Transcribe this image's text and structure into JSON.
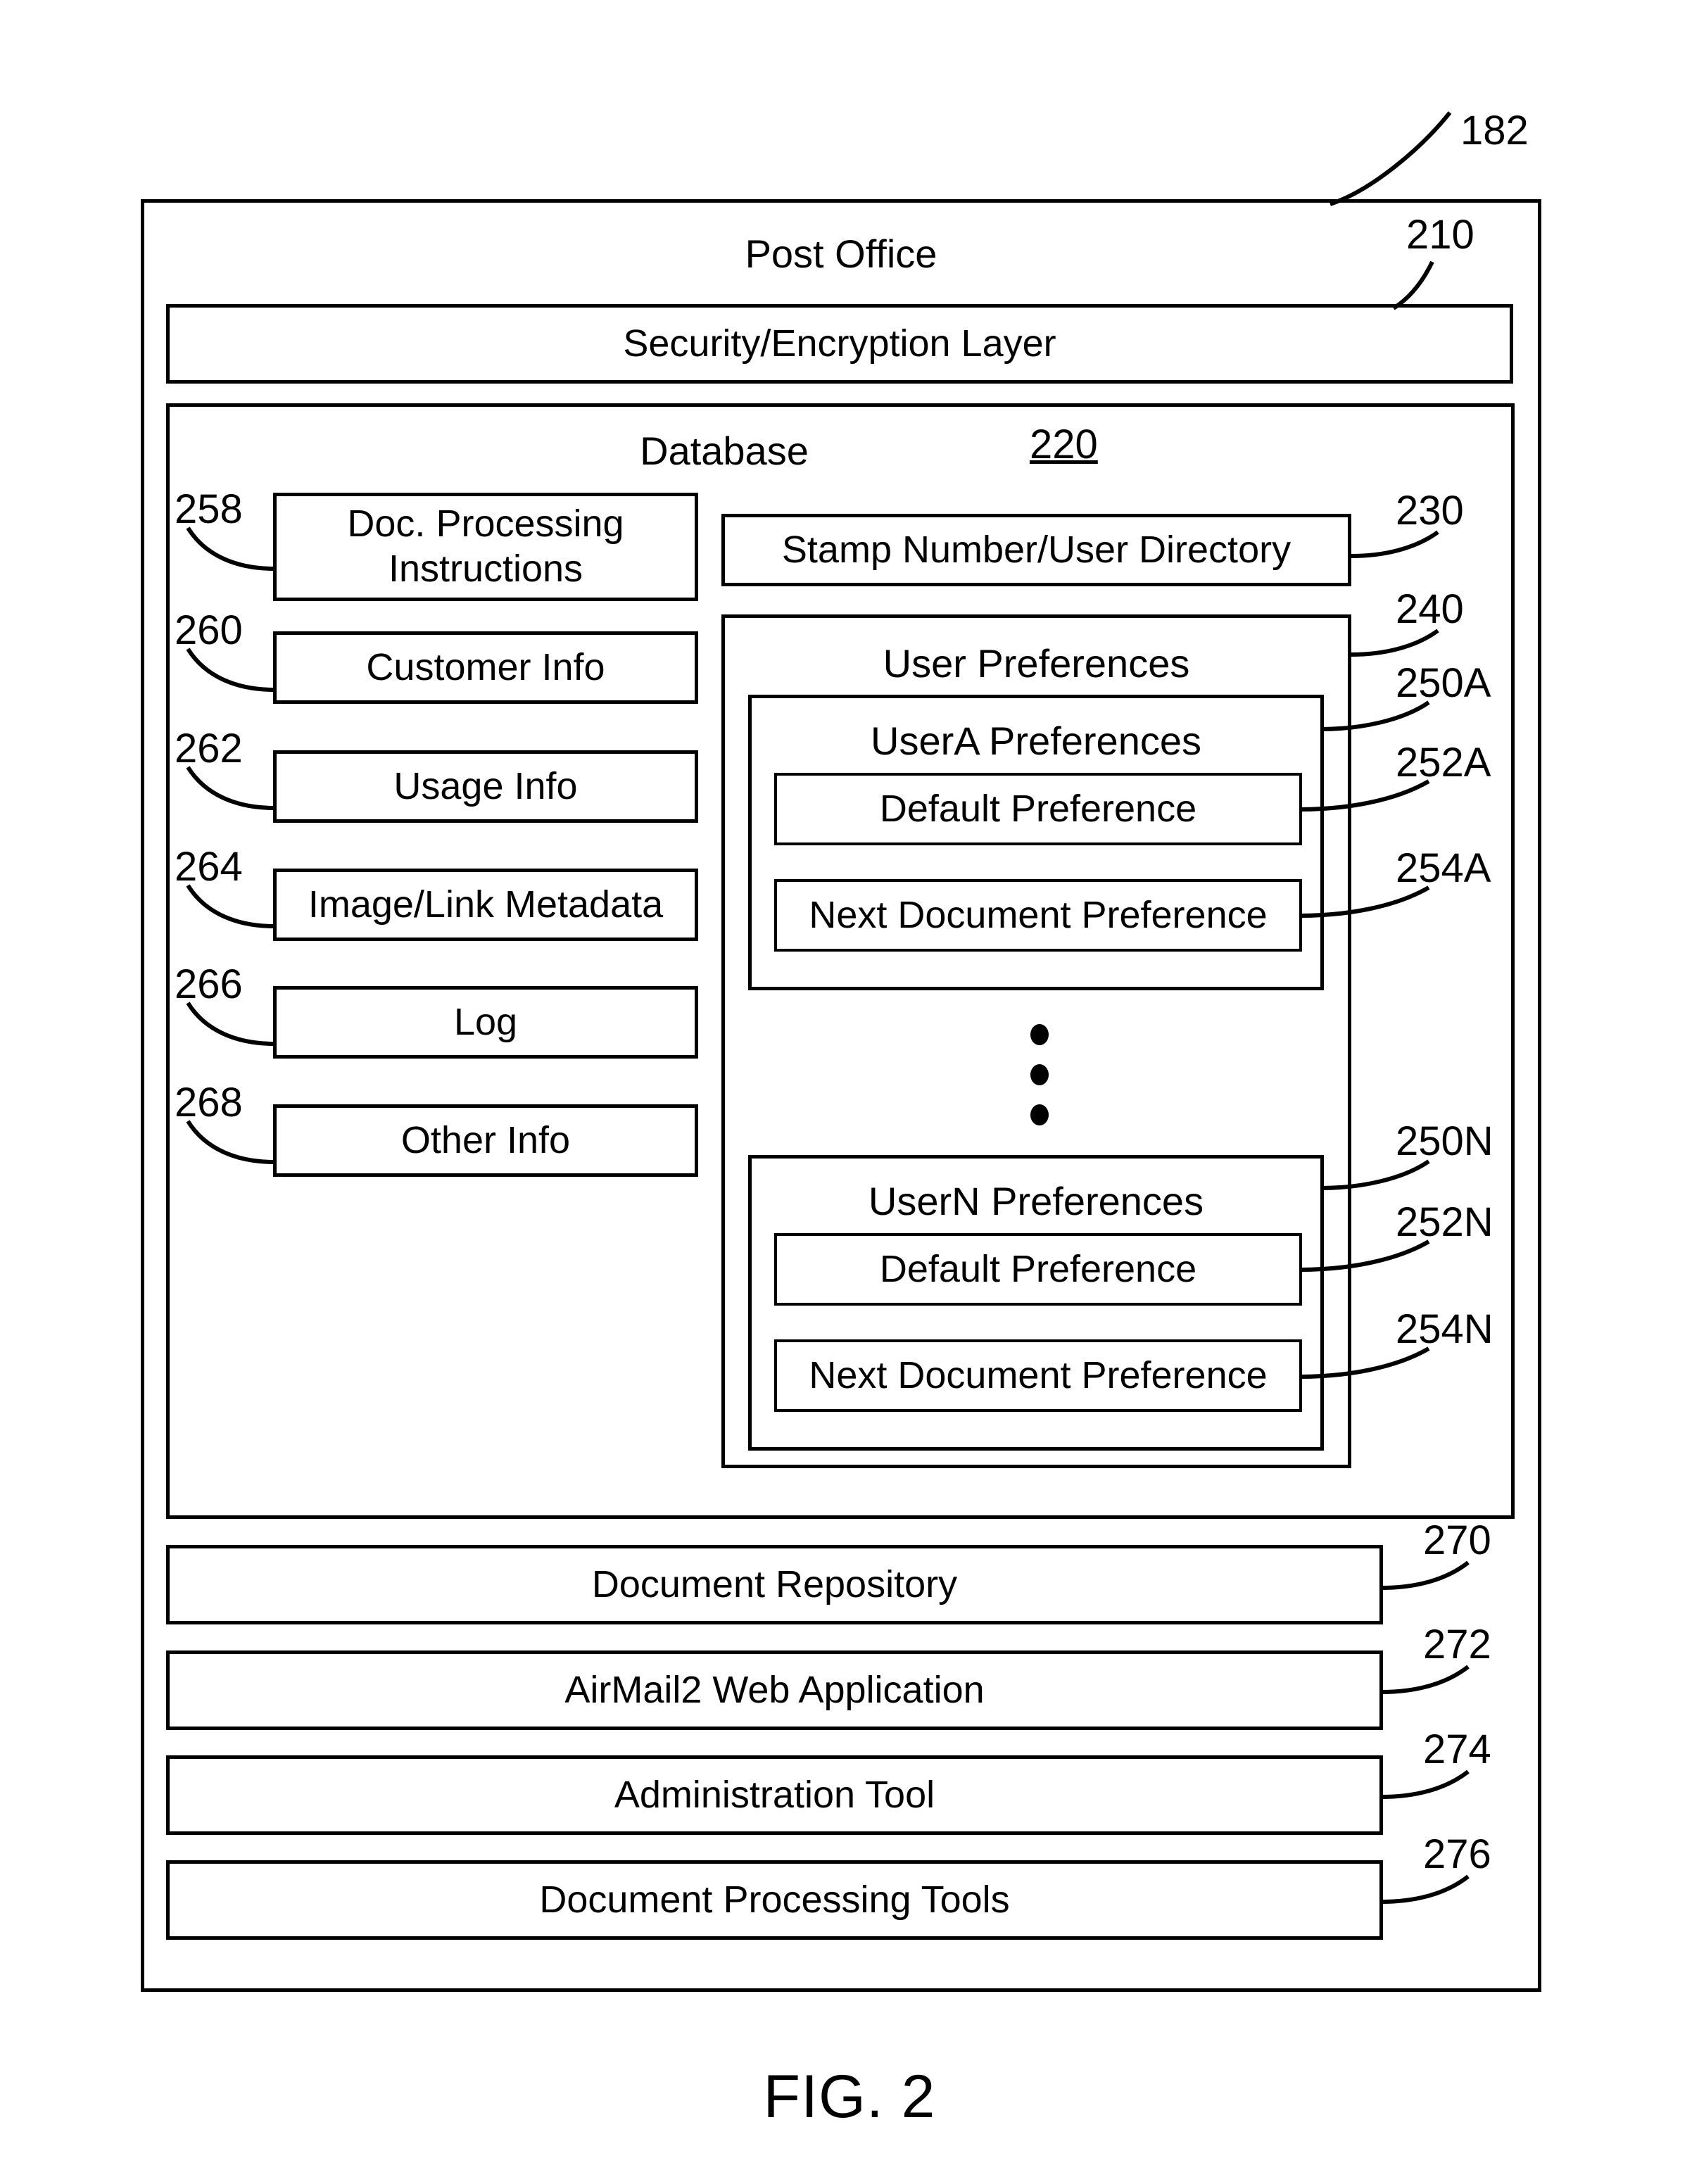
{
  "figure": {
    "caption": "FIG. 2",
    "outer_ref": "182"
  },
  "post_office": {
    "title": "Post Office",
    "ref": "210"
  },
  "security_layer": {
    "label": "Security/Encryption Layer"
  },
  "database": {
    "title": "Database",
    "ref": "220",
    "left_items": [
      {
        "label": "Doc. Processing Instructions",
        "ref": "258"
      },
      {
        "label": "Customer Info",
        "ref": "260"
      },
      {
        "label": "Usage Info",
        "ref": "262"
      },
      {
        "label": "Image/Link Metadata",
        "ref": "264"
      },
      {
        "label": "Log",
        "ref": "266"
      },
      {
        "label": "Other Info",
        "ref": "268"
      }
    ],
    "stamp_directory": {
      "label": "Stamp Number/User Directory",
      "ref": "230"
    },
    "user_preferences": {
      "title": "User Preferences",
      "ref": "240",
      "users": [
        {
          "title": "UserA Preferences",
          "ref": "250A",
          "default_preference": {
            "label": "Default Preference",
            "ref": "252A"
          },
          "next_document_preference": {
            "label": "Next Document Preference",
            "ref": "254A"
          }
        },
        {
          "title": "UserN Preferences",
          "ref": "250N",
          "default_preference": {
            "label": "Default Preference",
            "ref": "252N"
          },
          "next_document_preference": {
            "label": "Next Document Preference",
            "ref": "254N"
          }
        }
      ],
      "ellipsis": "vertical-dots"
    }
  },
  "modules": [
    {
      "label": "Document Repository",
      "ref": "270"
    },
    {
      "label": "AirMail2 Web Application",
      "ref": "272"
    },
    {
      "label": "Administration Tool",
      "ref": "274"
    },
    {
      "label": "Document Processing Tools",
      "ref": "276"
    }
  ]
}
